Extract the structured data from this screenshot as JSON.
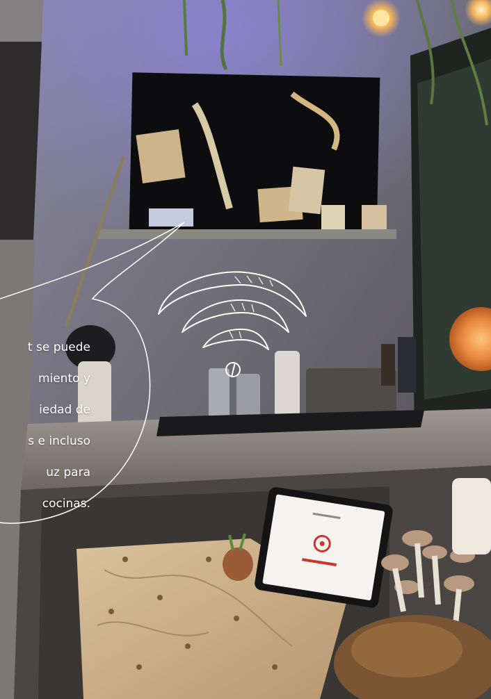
{
  "callout": {
    "lines": [
      "t se puede",
      "miento y",
      "iedad de",
      "s e incluso",
      "uz para",
      "cocinas."
    ]
  },
  "icons": {
    "wifi": "wifi-icon"
  },
  "colors": {
    "wall": "#6f6d72",
    "wall_light": "#9a97a6",
    "board": "#0d0c0e",
    "counter": "#7a7670",
    "plywood": "#cdb38d",
    "tablet": "#141414",
    "lamp": "#e98a3f",
    "outline": "#ffffff"
  }
}
